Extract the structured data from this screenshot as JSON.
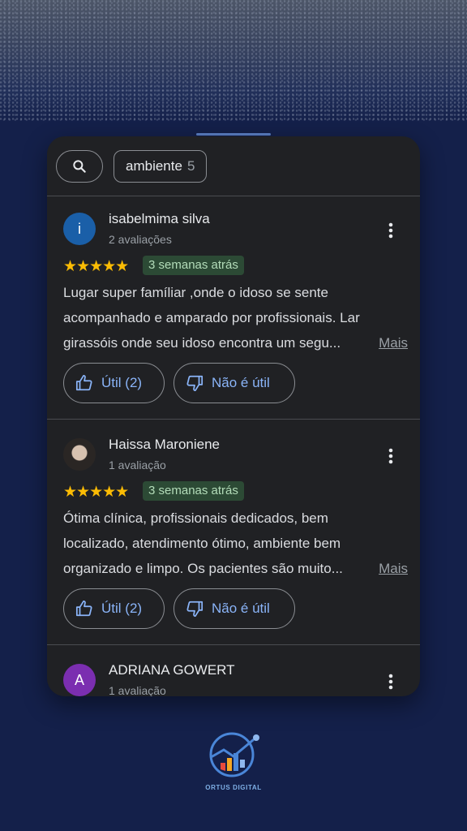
{
  "search": {
    "icon": "search-icon",
    "chip_label": "ambiente",
    "chip_count": "5"
  },
  "reviews": [
    {
      "avatar_letter": "i",
      "avatar_color": "#1a5fa8",
      "name": "isabelmima silva",
      "count": "2 avaliações",
      "rating": "★★★★★",
      "date": "3 semanas atrás",
      "lines": [
        "Lugar super famíliar ,onde o idoso se sente",
        "acompanhado e amparado por profissionais. Lar",
        "girassóis onde seu idoso  encontra um segu..."
      ],
      "more": "Mais",
      "useful": "Útil (2)",
      "not_useful": "Não é útil"
    },
    {
      "avatar_letter": "",
      "avatar_color": "#2a2624",
      "name": "Haissa Maroniene",
      "count": "1 avaliação",
      "rating": "★★★★★",
      "date": "3 semanas atrás",
      "lines": [
        "Ótima clínica, profissionais dedicados, bem",
        "localizado, atendimento ótimo, ambiente bem",
        "organizado e limpo. Os pacientes são muito..."
      ],
      "more": "Mais",
      "useful": "Útil (2)",
      "not_useful": "Não é útil"
    },
    {
      "avatar_letter": "A",
      "avatar_color": "#7b2eb0",
      "name": "ADRIANA GOWERT",
      "count": "1 avaliação"
    }
  ],
  "brand": {
    "name": "ORTUS DIGITAL",
    "accent": "#8ab4f8",
    "star_color": "#fbbc04"
  }
}
